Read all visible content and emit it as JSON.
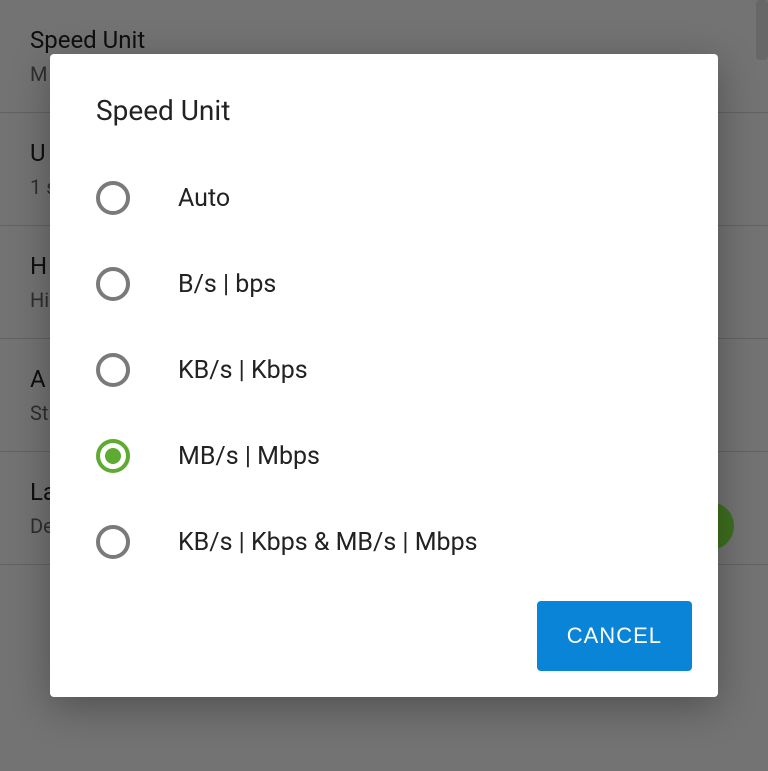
{
  "background": {
    "items": [
      {
        "title": "Speed Unit",
        "subtitle": "M"
      },
      {
        "title": "U",
        "subtitle": "1 s"
      },
      {
        "title": "H",
        "subtitle": "Hi ov"
      },
      {
        "title": "A",
        "subtitle": "St"
      },
      {
        "title": "La",
        "subtitle": "De"
      }
    ]
  },
  "dialog": {
    "title": "Speed Unit",
    "options": [
      {
        "label": "Auto",
        "selected": false
      },
      {
        "label": "B/s | bps",
        "selected": false
      },
      {
        "label": "KB/s | Kbps",
        "selected": false
      },
      {
        "label": "MB/s | Mbps",
        "selected": true
      },
      {
        "label": "KB/s | Kbps & MB/s | Mbps",
        "selected": false
      }
    ],
    "cancel_label": "CANCEL"
  }
}
